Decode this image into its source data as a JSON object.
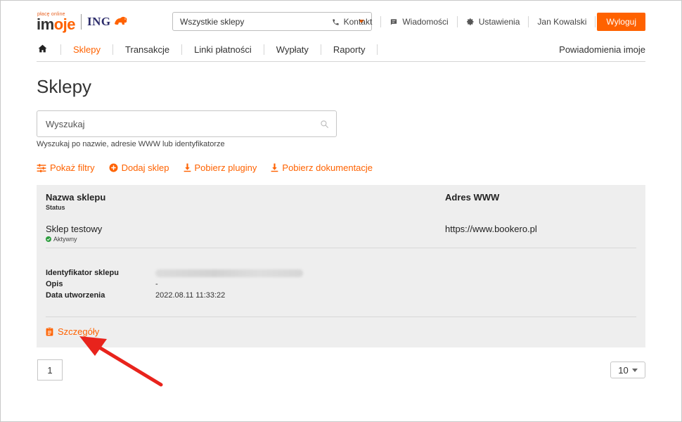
{
  "brand": {
    "tagline": "płacę online",
    "name_prefix": "im",
    "name_accent": "oje",
    "bank": "ING"
  },
  "header": {
    "store_select": "Wszystkie sklepy",
    "links": {
      "contact": "Kontakt",
      "messages": "Wiadomości",
      "settings": "Ustawienia",
      "user": "Jan Kowalski"
    },
    "logout": "Wyloguj"
  },
  "nav": {
    "items": [
      "Sklepy",
      "Transakcje",
      "Linki płatności",
      "Wypłaty",
      "Raporty"
    ],
    "notifications": "Powiadomienia imoje"
  },
  "page": {
    "title": "Sklepy"
  },
  "search": {
    "placeholder": "Wyszukaj",
    "hint": "Wyszukaj po nazwie, adresie WWW lub identyfikatorze"
  },
  "actions": {
    "filters": "Pokaż filtry",
    "add_store": "Dodaj sklep",
    "plugins": "Pobierz pluginy",
    "docs": "Pobierz dokumentacje"
  },
  "table": {
    "headers": {
      "name": "Nazwa sklepu",
      "status": "Status",
      "url": "Adres WWW"
    },
    "rows": [
      {
        "name": "Sklep testowy",
        "status": "Aktywny",
        "url": "https://www.bookero.pl",
        "details": {
          "id_label": "Identyfikator sklepu",
          "desc_label": "Opis",
          "desc_value": "-",
          "created_label": "Data utworzenia",
          "created_value": "2022.08.11 11:33:22"
        },
        "details_link": "Szczegóły"
      }
    ]
  },
  "pagination": {
    "current_page": "1",
    "per_page": "10"
  },
  "colors": {
    "accent": "#ff6200",
    "annotation": "#e8231c",
    "status_ok": "#2e9e3f"
  }
}
